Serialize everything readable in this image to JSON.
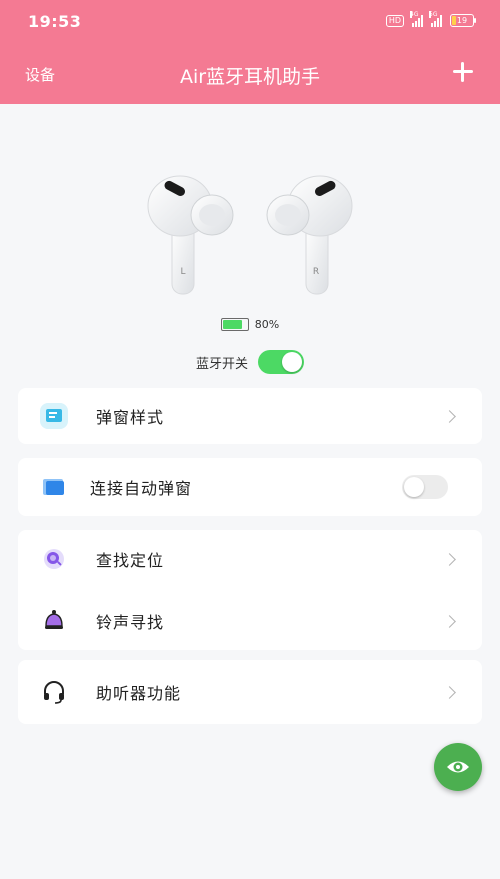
{
  "status_bar": {
    "time": "19:53",
    "hd_label": "HD",
    "signal1_label": "4G",
    "signal2_label": "5G",
    "battery_level": "19"
  },
  "nav": {
    "left_label": "设备",
    "title": "Air蓝牙耳机助手",
    "right_icon": "plus-icon"
  },
  "device": {
    "left_bud_mark": "L",
    "right_bud_mark": "R",
    "battery_percent": "80%",
    "battery_fraction": 0.8,
    "bluetooth_label": "蓝牙开关",
    "bluetooth_on": true
  },
  "settings": {
    "popup_style": {
      "label": "弹窗样式",
      "icon": "popup-style-icon"
    },
    "auto_popup": {
      "label": "连接自动弹窗",
      "icon": "auto-popup-icon",
      "enabled": false
    },
    "find_location": {
      "label": "查找定位",
      "icon": "location-search-icon"
    },
    "ring_find": {
      "label": "铃声寻找",
      "icon": "bell-icon"
    },
    "hearing_aid": {
      "label": "助听器功能",
      "icon": "headset-icon"
    }
  },
  "fab": {
    "icon": "eye-icon"
  },
  "colors": {
    "header": "#f47a93",
    "toggle_on": "#4cd964",
    "fab": "#4caf50",
    "background": "#f6f7f9"
  }
}
